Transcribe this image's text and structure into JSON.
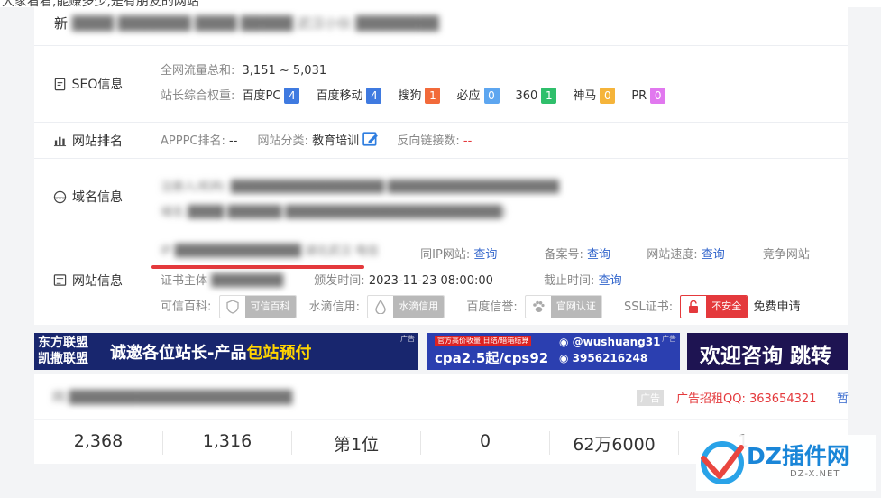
{
  "top_text": "大家看看,能赚多少,是有朋友的网站",
  "site_title_prefix": "新",
  "site_title_blur": "████ ███████ ████ █████ 武汉小伙 ████████",
  "seo": {
    "label": "SEO信息",
    "traffic_label": "全网流量总和:",
    "traffic_value": "3,151 ~ 5,031",
    "weight_label": "站长综合权重:",
    "weights": [
      {
        "name": "百度PC",
        "value": "4",
        "color": "#3f7ae0"
      },
      {
        "name": "百度移动",
        "value": "4",
        "color": "#3f7ae0"
      },
      {
        "name": "搜狗",
        "value": "1",
        "color": "#f26a3a"
      },
      {
        "name": "必应",
        "value": "0",
        "color": "#5da6f0"
      },
      {
        "name": "360",
        "value": "1",
        "color": "#2fbf6b"
      },
      {
        "name": "神马",
        "value": "0",
        "color": "#f5b43a"
      },
      {
        "name": "PR",
        "value": "0",
        "color": "#e178ef"
      }
    ]
  },
  "rank": {
    "label": "网站排名",
    "apppc_label": "APPPC排名:",
    "apppc_value": "--",
    "category_label": "网站分类:",
    "category_value": "教育培训",
    "backlinks_label": "反向链接数:",
    "backlinks_value": "--"
  },
  "domain": {
    "label": "域名信息",
    "line1_blur": "注册人/机构: █████████████████   ███████████████████",
    "line2_blur": "域名 ████  ██████ ████████████████████████)"
  },
  "site": {
    "label": "网站信息",
    "ip_blur": "IP ██████████████ 湖北武汉 电信",
    "same_ip_label": "同IP网站:",
    "same_ip_link": "查询",
    "icp_label": "备案号:",
    "icp_link": "查询",
    "speed_label": "网站速度:",
    "speed_link": "查询",
    "compete_label": "竞争网站",
    "cert_owner_label": "证书主体",
    "cert_owner_blur": "████████",
    "issue_label": "颁发时间:",
    "issue_value": "2023-11-23 08:00:00",
    "expire_label": "截止时间:",
    "expire_link": "查询",
    "baike_label": "可信百科:",
    "baike_badge": "可信百科",
    "shuidi_label": "水滴信用:",
    "shuidi_badge": "水滴信用",
    "baidu_label": "百度信誉:",
    "baidu_badge": "官网认证",
    "ssl_label": "SSL证书:",
    "ssl_badge": "不安全",
    "ssl_apply": "免费申请"
  },
  "banners": {
    "b1_left": [
      "东方联盟",
      "凯撒联盟"
    ],
    "b1_main": "诚邀各位站长-产品",
    "b1_highlight": "包站",
    "b1_tail": "预付",
    "b2_top": "官方高价收量 日结/暗箱结算",
    "b2_main": "cpa2.5起/cps92",
    "b2_handle": "@wushuang31",
    "b2_number": "3956216248",
    "b3_text": "欢迎咨询 跳转",
    "ad_tag": "广告"
  },
  "ad_row": {
    "blur_text": "网 ███████████████████████",
    "ad_tag": "广告",
    "contact": "广告招租QQ: 363654321",
    "extra": "暂"
  },
  "stats": [
    "2,368",
    "1,316",
    "第1位",
    "0",
    "62万6000",
    "1"
  ],
  "watermark": {
    "brand": "DZ插件网",
    "url": "DZ-X.NET"
  },
  "colors": {
    "link": "#3366cc",
    "underline": "#e4393c",
    "banner_bg": "#1b2a6b",
    "highlight": "#ffd400"
  }
}
